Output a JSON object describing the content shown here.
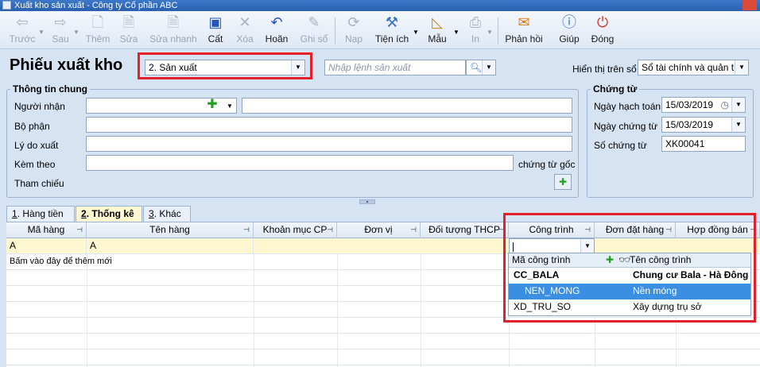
{
  "window": {
    "title": "Xuất kho sản xuất - Công ty Cổ phần ABC"
  },
  "toolbar": {
    "prev": "Trước",
    "next": "Sau",
    "add": "Thêm",
    "edit": "Sửa",
    "quick_edit": "Sửa nhanh",
    "save": "Cất",
    "delete": "Xóa",
    "undo": "Hoãn",
    "post": "Ghi sổ",
    "load": "Nạp",
    "utilities": "Tiện ích",
    "template": "Mẫu",
    "print": "In",
    "feedback": "Phản hồi",
    "help": "Giúp",
    "close": "Đóng"
  },
  "header": {
    "title": "Phiếu xuất kho",
    "type_value": "2. Sản xuất",
    "order_placeholder": "Nhập lệnh sản xuất",
    "display_label": "Hiển thị trên sổ",
    "display_value": "Sổ tài chính và quản trị"
  },
  "general": {
    "title": "Thông tin chung",
    "recipient_label": "Người nhận",
    "department_label": "Bộ phận",
    "reason_label": "Lý do xuất",
    "attach_label": "Kèm theo",
    "attach_suffix": "chứng từ gốc",
    "reference_label": "Tham chiếu"
  },
  "voucher": {
    "title": "Chứng từ",
    "posting_date_label": "Ngày hạch toán",
    "posting_date": "15/03/2019",
    "voucher_date_label": "Ngày chứng từ",
    "voucher_date": "15/03/2019",
    "voucher_no_label": "Số chứng từ",
    "voucher_no": "XK00041"
  },
  "tabs": [
    {
      "key": "1",
      "label": "Hàng tiền"
    },
    {
      "key": "2",
      "label": "Thống kê"
    },
    {
      "key": "3",
      "label": "Khác"
    }
  ],
  "grid": {
    "columns": [
      "Mã hàng",
      "Tên hàng",
      "Khoản mục CP",
      "Đơn vị",
      "Đối tượng THCP",
      "Công trình",
      "Đơn đặt hàng",
      "Hợp đồng bán"
    ],
    "row1": {
      "code": "A",
      "name": "A"
    },
    "add_hint": "Bấm vào đây để thêm mới"
  },
  "popup": {
    "col_code": "Mã công trình",
    "col_name": "Tên công trình",
    "items": [
      {
        "code": "CC_BALA",
        "name": "Chung cư Bala - Hà Đông"
      },
      {
        "code": "NEN_MONG",
        "name": "Nền móng"
      },
      {
        "code": "XD_TRU_SO",
        "name": "Xây dựng trụ sở"
      }
    ]
  },
  "colors": {
    "highlight": "#e5202a",
    "selection": "#3a8fe3",
    "edit_row": "#fff7cf"
  }
}
